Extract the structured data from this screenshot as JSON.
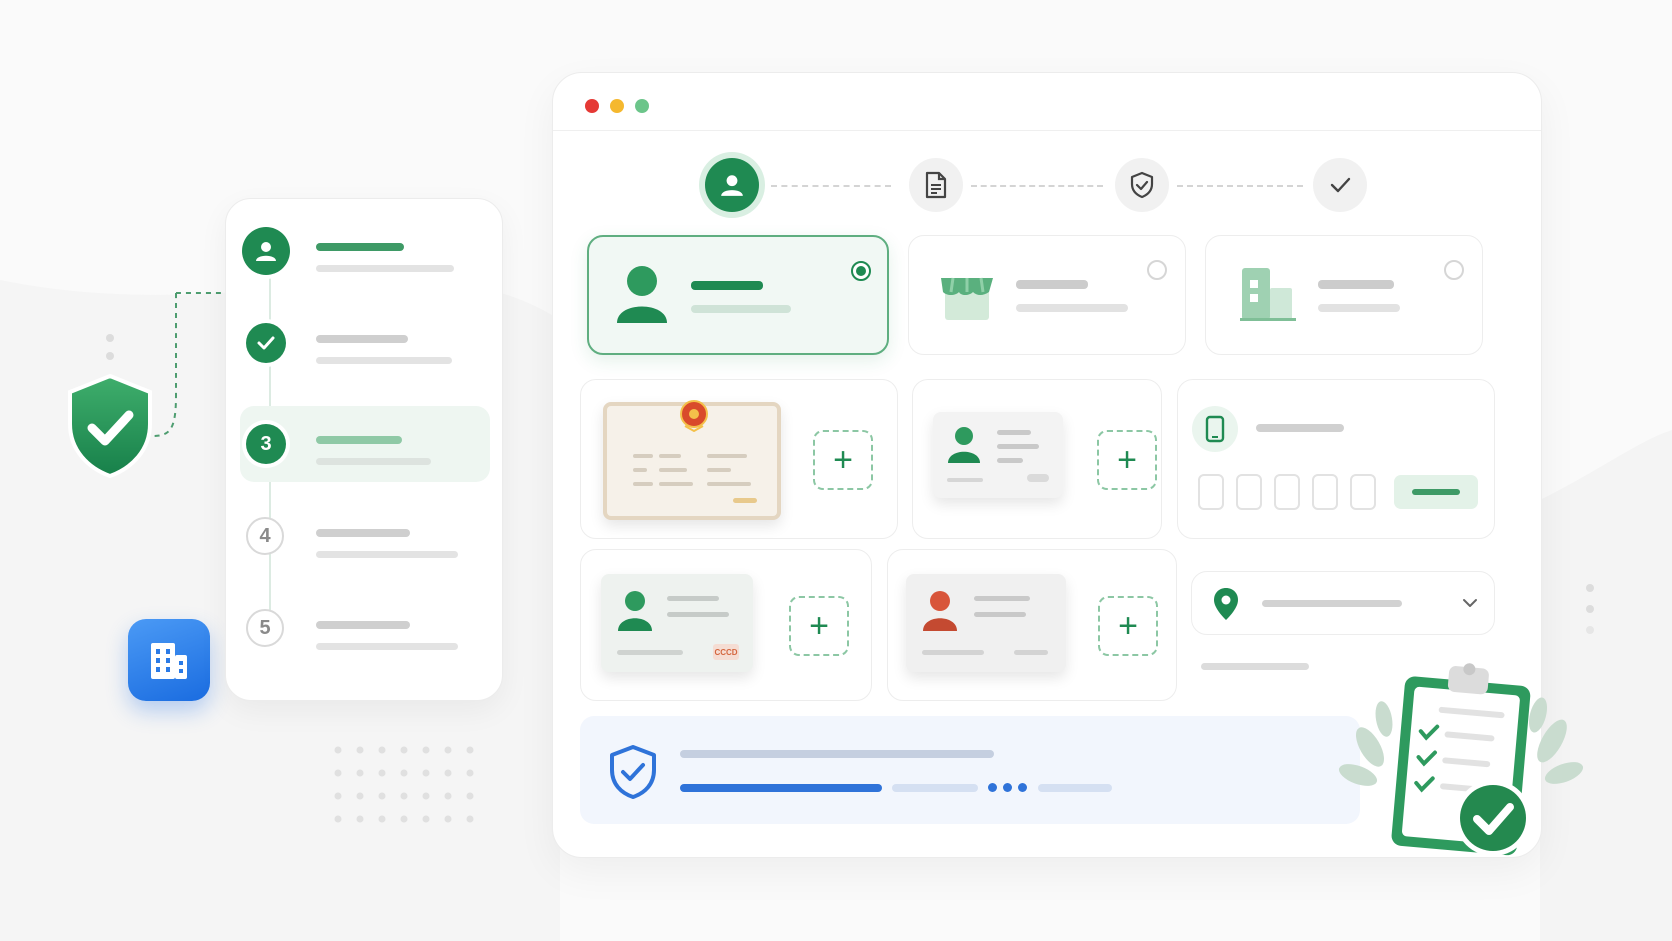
{
  "window": {
    "traffic_lights": [
      "#e53935",
      "#f5b82e",
      "#6cc58a"
    ]
  },
  "colors": {
    "primary": "#1f8a52",
    "primary_light": "#d9efe2",
    "accent_blue": "#3b82e8",
    "muted": "#cfcfcf"
  },
  "sidebar": {
    "steps": [
      {
        "marker": "user-icon",
        "state": "done"
      },
      {
        "marker": "check-icon",
        "state": "done"
      },
      {
        "marker": "3",
        "state": "active"
      },
      {
        "marker": "4",
        "state": "pending"
      },
      {
        "marker": "5",
        "state": "pending"
      }
    ]
  },
  "progress": {
    "steps": [
      {
        "icon": "user-icon",
        "state": "active"
      },
      {
        "icon": "document-icon",
        "state": "pending"
      },
      {
        "icon": "shield-check-icon",
        "state": "pending"
      },
      {
        "icon": "check-icon",
        "state": "pending"
      }
    ]
  },
  "entity_types": [
    {
      "icon": "person-icon",
      "selected": true
    },
    {
      "icon": "store-icon",
      "selected": false
    },
    {
      "icon": "building-icon",
      "selected": false
    }
  ],
  "uploads": {
    "add_symbol": "+",
    "id_stamp_text": "CCCD"
  },
  "phone_verify": {
    "icon": "phone-icon",
    "otp_length": 5
  },
  "location": {
    "icon": "location-pin-icon",
    "dropdown_icon": "chevron-down-icon"
  },
  "verification": {
    "icon": "shield-check-icon",
    "progress": 0.3,
    "loading_dots": 3
  },
  "decorations": {
    "floating_shield_icon": "shield-check-icon",
    "floating_building_icon": "building-icon",
    "clipboard_icon": "clipboard-checklist-icon"
  }
}
